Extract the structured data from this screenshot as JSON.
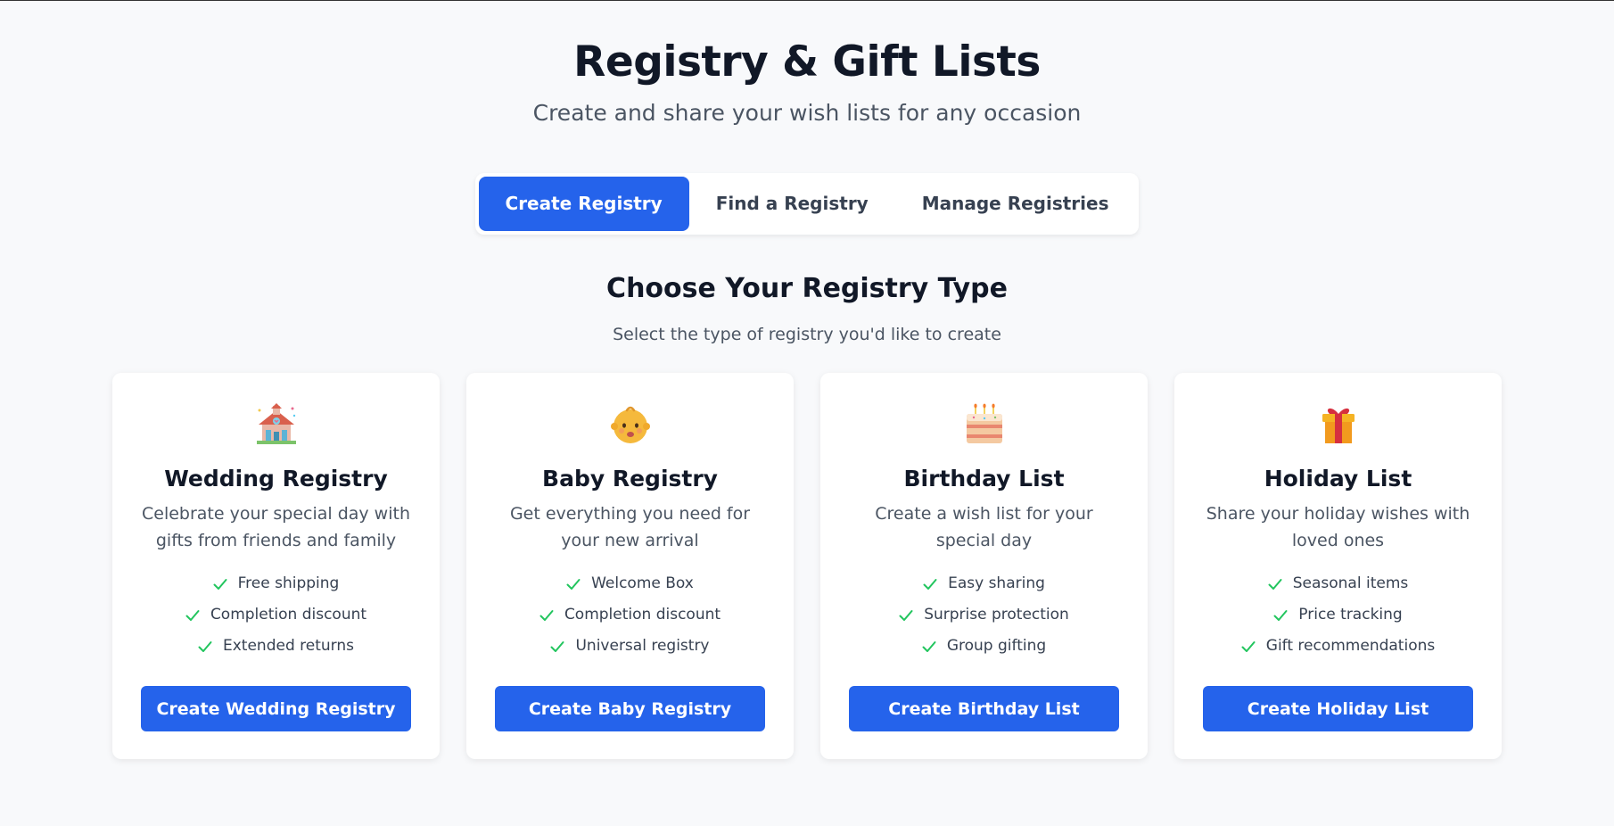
{
  "header": {
    "title": "Registry & Gift Lists",
    "subtitle": "Create and share your wish lists for any occasion"
  },
  "tabs": [
    {
      "label": "Create Registry",
      "active": true
    },
    {
      "label": "Find a Registry",
      "active": false
    },
    {
      "label": "Manage Registries",
      "active": false
    }
  ],
  "section": {
    "title": "Choose Your Registry Type",
    "subtitle": "Select the type of registry you'd like to create"
  },
  "cards": [
    {
      "icon": "wedding-chapel-icon",
      "title": "Wedding Registry",
      "description": "Celebrate your special day with gifts from friends and family",
      "features": [
        "Free shipping",
        "Completion discount",
        "Extended returns"
      ],
      "button": "Create Wedding Registry"
    },
    {
      "icon": "baby-face-icon",
      "title": "Baby Registry",
      "description": "Get everything you need for your new arrival",
      "features": [
        "Welcome Box",
        "Completion discount",
        "Universal registry"
      ],
      "button": "Create Baby Registry"
    },
    {
      "icon": "birthday-cake-icon",
      "title": "Birthday List",
      "description": "Create a wish list for your special day",
      "features": [
        "Easy sharing",
        "Surprise protection",
        "Group gifting"
      ],
      "button": "Create Birthday List"
    },
    {
      "icon": "gift-box-icon",
      "title": "Holiday List",
      "description": "Share your holiday wishes with loved ones",
      "features": [
        "Seasonal items",
        "Price tracking",
        "Gift recommendations"
      ],
      "button": "Create Holiday List"
    }
  ],
  "colors": {
    "accent": "#2563eb",
    "check": "#22c55e",
    "background": "#f8f9fb"
  }
}
